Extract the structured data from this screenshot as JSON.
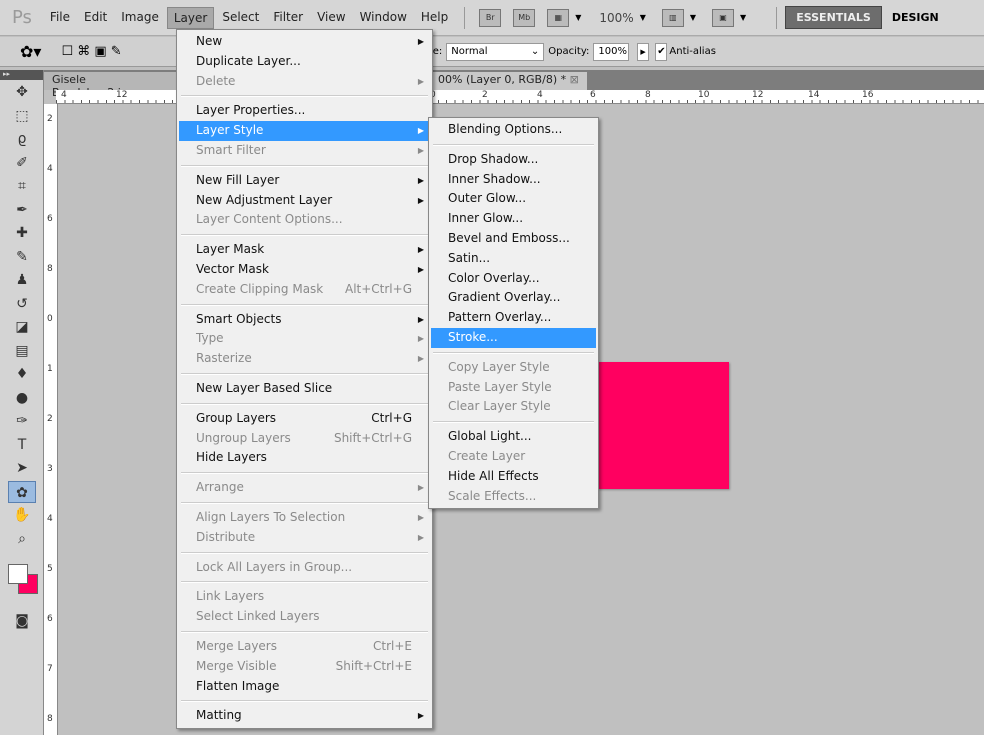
{
  "app": {
    "logo": "Ps",
    "menus": [
      "File",
      "Edit",
      "Image",
      "Layer",
      "Select",
      "Filter",
      "View",
      "Window",
      "Help"
    ],
    "active_menu": "Layer",
    "toolbar_icons": [
      "Br",
      "Mb"
    ],
    "zoom": "100%",
    "workspaces": [
      "ESSENTIALS",
      "DESIGN"
    ]
  },
  "options": {
    "mode_label": "Mode:",
    "mode_value": "Normal",
    "opacity_label": "Opacity:",
    "opacity_value": "100%",
    "antialias_label": "Anti-alias",
    "antialias_checked": true
  },
  "tabs": [
    {
      "label": "Gisele Bundchen2.jpg"
    },
    {
      "label": "00% (Layer 0, RGB/8) *"
    }
  ],
  "ruler": {
    "top": [
      "4",
      "12",
      "0",
      "2",
      "4",
      "6",
      "8",
      "10",
      "12",
      "14",
      "16"
    ],
    "left": [
      "2",
      "4",
      "6",
      "8",
      "0",
      "1",
      "2",
      "3",
      "4",
      "5",
      "6",
      "7",
      "8"
    ]
  },
  "colors": {
    "foreground": "#ffffff",
    "background": "#ff0060",
    "highlight": "#3399ff",
    "shape": "#ff0060"
  },
  "layer_menu": [
    {
      "label": "New",
      "arrow": true
    },
    {
      "label": "Duplicate Layer..."
    },
    {
      "label": "Delete",
      "disabled": true,
      "arrow": true
    },
    {
      "sep": true
    },
    {
      "label": "Layer Properties..."
    },
    {
      "label": "Layer Style",
      "arrow": true,
      "highlighted": true
    },
    {
      "label": "Smart Filter",
      "disabled": true,
      "arrow": true
    },
    {
      "sep": true
    },
    {
      "label": "New Fill Layer",
      "arrow": true
    },
    {
      "label": "New Adjustment Layer",
      "arrow": true
    },
    {
      "label": "Layer Content Options...",
      "disabled": true
    },
    {
      "sep": true
    },
    {
      "label": "Layer Mask",
      "arrow": true
    },
    {
      "label": "Vector Mask",
      "arrow": true
    },
    {
      "label": "Create Clipping Mask",
      "disabled": true,
      "shortcut": "Alt+Ctrl+G"
    },
    {
      "sep": true
    },
    {
      "label": "Smart Objects",
      "arrow": true
    },
    {
      "label": "Type",
      "disabled": true,
      "arrow": true
    },
    {
      "label": "Rasterize",
      "disabled": true,
      "arrow": true
    },
    {
      "sep": true
    },
    {
      "label": "New Layer Based Slice"
    },
    {
      "sep": true
    },
    {
      "label": "Group Layers",
      "shortcut": "Ctrl+G"
    },
    {
      "label": "Ungroup Layers",
      "disabled": true,
      "shortcut": "Shift+Ctrl+G"
    },
    {
      "label": "Hide Layers"
    },
    {
      "sep": true
    },
    {
      "label": "Arrange",
      "disabled": true,
      "arrow": true
    },
    {
      "sep": true
    },
    {
      "label": "Align Layers To Selection",
      "disabled": true,
      "arrow": true
    },
    {
      "label": "Distribute",
      "disabled": true,
      "arrow": true
    },
    {
      "sep": true
    },
    {
      "label": "Lock All Layers in Group...",
      "disabled": true
    },
    {
      "sep": true
    },
    {
      "label": "Link Layers",
      "disabled": true
    },
    {
      "label": "Select Linked Layers",
      "disabled": true
    },
    {
      "sep": true
    },
    {
      "label": "Merge Layers",
      "disabled": true,
      "shortcut": "Ctrl+E"
    },
    {
      "label": "Merge Visible",
      "disabled": true,
      "shortcut": "Shift+Ctrl+E"
    },
    {
      "label": "Flatten Image"
    },
    {
      "sep": true
    },
    {
      "label": "Matting",
      "arrow": true
    }
  ],
  "layer_style_menu": [
    {
      "label": "Blending Options..."
    },
    {
      "sep": true
    },
    {
      "label": "Drop Shadow..."
    },
    {
      "label": "Inner Shadow..."
    },
    {
      "label": "Outer Glow..."
    },
    {
      "label": "Inner Glow..."
    },
    {
      "label": "Bevel and Emboss..."
    },
    {
      "label": "Satin..."
    },
    {
      "label": "Color Overlay..."
    },
    {
      "label": "Gradient Overlay..."
    },
    {
      "label": "Pattern Overlay..."
    },
    {
      "label": "Stroke...",
      "highlighted": true
    },
    {
      "sep": true
    },
    {
      "label": "Copy Layer Style",
      "disabled": true
    },
    {
      "label": "Paste Layer Style",
      "disabled": true
    },
    {
      "label": "Clear Layer Style",
      "disabled": true
    },
    {
      "sep": true
    },
    {
      "label": "Global Light..."
    },
    {
      "label": "Create Layer",
      "disabled": true
    },
    {
      "label": "Hide All Effects"
    },
    {
      "label": "Scale Effects...",
      "disabled": true
    }
  ]
}
